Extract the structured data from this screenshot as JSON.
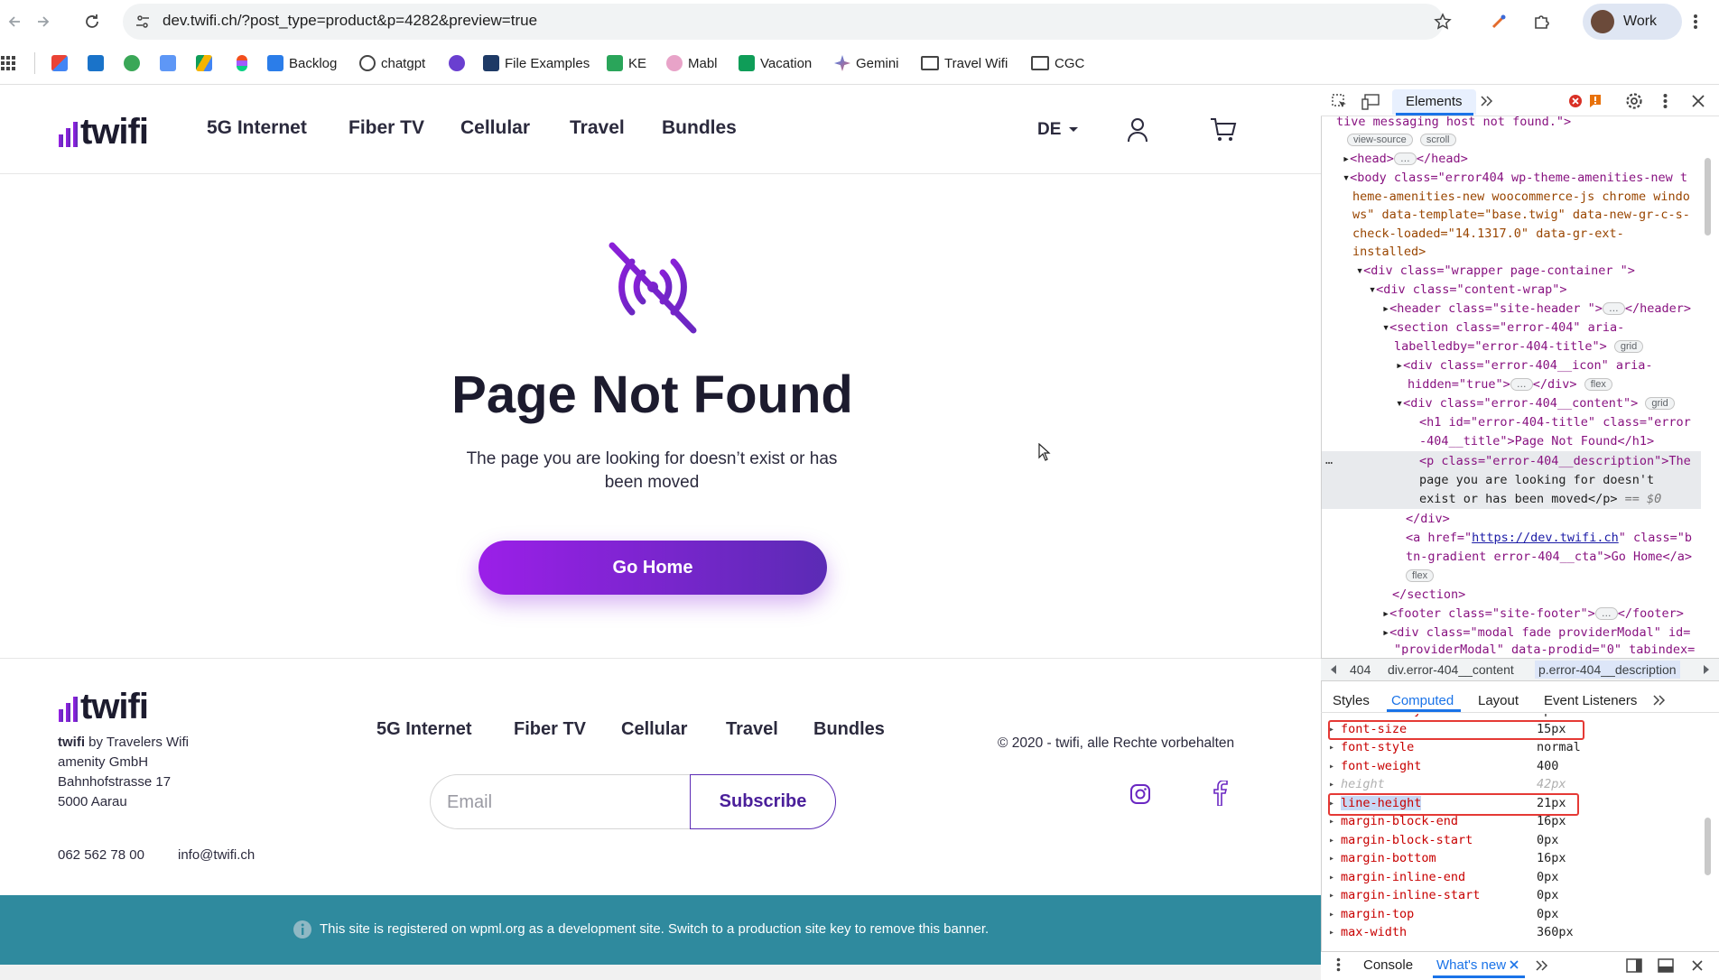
{
  "browser": {
    "url": "dev.twifi.ch/?post_type=product&p=4282&preview=true",
    "profile_label": "Work",
    "bookmarks": [
      {
        "label": ""
      },
      {
        "label": ""
      },
      {
        "label": ""
      },
      {
        "label": ""
      },
      {
        "label": ""
      },
      {
        "label": "Backlog"
      },
      {
        "label": "chatgpt"
      },
      {
        "label": ""
      },
      {
        "label": "File Examples"
      },
      {
        "label": "KE"
      },
      {
        "label": "Mabl"
      },
      {
        "label": "Vacation"
      },
      {
        "label": "Gemini"
      },
      {
        "label": "Travel Wifi"
      },
      {
        "label": "CGC"
      }
    ]
  },
  "site": {
    "logo_text": "twifi",
    "nav": [
      "5G Internet",
      "Fiber TV",
      "Cellular",
      "Travel",
      "Bundles"
    ],
    "lang": "DE",
    "error": {
      "title": "Page Not Found",
      "description": "The page you are looking for doesn’t exist or has been moved",
      "cta": "Go Home"
    },
    "footer": {
      "brand_bold": "twifi",
      "brand_rest": " by Travelers Wifi",
      "address": [
        "amenity GmbH",
        "Bahnhofstrasse 17",
        "5000 Aarau"
      ],
      "phone": "062 562 78 00",
      "email": "info@twifi.ch",
      "nav": [
        "5G Internet",
        "Fiber TV",
        "Cellular",
        "Travel",
        "Bundles"
      ],
      "copyright": "© 2020 - twifi, alle Rechte vorbehalten",
      "email_placeholder": "Email",
      "subscribe": "Subscribe"
    },
    "wpml_banner": "This site is registered on wpml.org as a development site. Switch to a production site key to remove this banner."
  },
  "devtools": {
    "tab_active": "Elements",
    "error_count": "",
    "code_lines": {
      "l0": "tive messaging host not found.\">",
      "badge_view_source": "view-source",
      "badge_scroll": "scroll",
      "head": "<head>",
      "head_close": "</head>",
      "body_1": "<body class=\"error404 wp-theme-amenities-new t",
      "body_2": "heme-amenities-new woocommerce-js chrome windo",
      "body_3": "ws\" data-template=\"base.twig\" data-new-gr-c-s-",
      "body_4": "check-loaded=\"14.1317.0\" data-gr-ext-",
      "body_5": "installed>",
      "wrapper": "<div class=\"wrapper page-container \">",
      "content_wrap": "<div class=\"content-wrap\">",
      "header": "<header class=\"site-header \">",
      "header_close": "</header>",
      "section_1": "<section class=\"error-404\" aria-",
      "section_2": "labelledby=\"error-404-title\">",
      "badge_grid": "grid",
      "icon_1": "<div class=\"error-404__icon\" aria-",
      "icon_2": "hidden=\"true\">",
      "icon_close": "</div>",
      "badge_flex": "flex",
      "content_div": "<div class=\"error-404__content\">",
      "h1_1": "<h1 id=\"error-404-title\" class=\"error",
      "h1_2": "-404__title\">Page Not Found</h1>",
      "p_1": "<p class=\"error-404__description\">The",
      "p_2": "page you are looking for doesn't",
      "p_3": "exist or has been moved</p>",
      "p_eq": "== $0",
      "div_close": "</div>",
      "a_1": "<a href=\"",
      "a_href": "https://dev.twifi.ch",
      "a_2": "\" class=\"b",
      "a_3": "tn-gradient error-404__cta\">Go Home</a>",
      "section_close": "</section>",
      "footer": "<footer class=\"site-footer\">",
      "footer_close": "</footer>",
      "modal_1": "<div class=\"modal fade providerModal\" id=",
      "modal_2": "\"providerModal\" data-prodid=\"0\" tabindex="
    },
    "breadcrumbs": [
      "404",
      "div.error-404__content",
      "p.error-404__description"
    ],
    "subtabs": [
      "Styles",
      "Computed",
      "Layout",
      "Event Listeners"
    ],
    "computed": [
      {
        "name": "font-family",
        "value": "Space Grotesk",
        "dim": false
      },
      {
        "name": "font-size",
        "value": "15px",
        "dim": false
      },
      {
        "name": "font-style",
        "value": "normal",
        "dim": false
      },
      {
        "name": "font-weight",
        "value": "400",
        "dim": false
      },
      {
        "name": "height",
        "value": "42px",
        "dim": true
      },
      {
        "name": "line-height",
        "value": "21px",
        "dim": false
      },
      {
        "name": "margin-block-end",
        "value": "16px",
        "dim": false
      },
      {
        "name": "margin-block-start",
        "value": "0px",
        "dim": false
      },
      {
        "name": "margin-bottom",
        "value": "16px",
        "dim": false
      },
      {
        "name": "margin-inline-end",
        "value": "0px",
        "dim": false
      },
      {
        "name": "margin-inline-start",
        "value": "0px",
        "dim": false
      },
      {
        "name": "margin-top",
        "value": "0px",
        "dim": false
      },
      {
        "name": "max-width",
        "value": "360px",
        "dim": false
      }
    ],
    "drawer_tabs": [
      "Console",
      "What's new"
    ]
  },
  "colors": {
    "brand_purple": "#5b2bb5",
    "brand_violet": "#9b1fe8",
    "wpml_teal": "#2f8a9e",
    "devtools_blue": "#1a73e8",
    "highlight_red": "#e53935"
  }
}
